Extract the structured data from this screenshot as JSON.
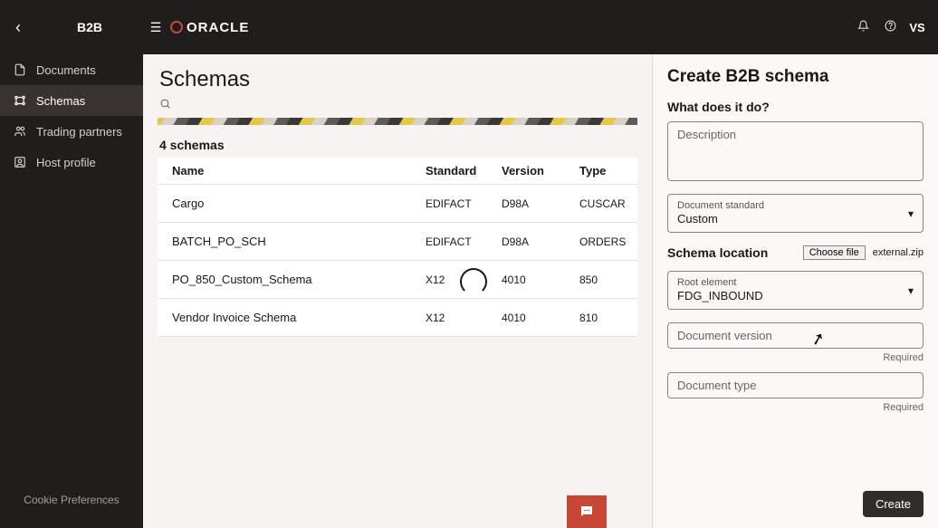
{
  "topbar": {
    "app_title": "B2B",
    "logo_text": "ORACLE",
    "user_initials": "VS"
  },
  "sidebar": {
    "items": [
      {
        "label": "Documents"
      },
      {
        "label": "Schemas"
      },
      {
        "label": "Trading partners"
      },
      {
        "label": "Host profile"
      }
    ],
    "cookie_label": "Cookie Preferences"
  },
  "main": {
    "page_title": "Schemas",
    "count_text": "4 schemas",
    "columns": {
      "name": "Name",
      "standard": "Standard",
      "version": "Version",
      "type": "Type"
    },
    "rows": [
      {
        "name": "Cargo",
        "standard": "EDIFACT",
        "version": "D98A",
        "type": "CUSCAR"
      },
      {
        "name": "BATCH_PO_SCH",
        "standard": "EDIFACT",
        "version": "D98A",
        "type": "ORDERS"
      },
      {
        "name": "PO_850_Custom_Schema",
        "standard": "X12",
        "version": "4010",
        "type": "850"
      },
      {
        "name": "Vendor Invoice Schema",
        "standard": "X12",
        "version": "4010",
        "type": "810"
      }
    ]
  },
  "panel": {
    "title": "Create B2B schema",
    "what_label": "What does it do?",
    "description_placeholder": "Description",
    "doc_standard_label": "Document standard",
    "doc_standard_value": "Custom",
    "schema_location_label": "Schema location",
    "choose_file_label": "Choose file",
    "file_name": "external.zip",
    "root_element_label": "Root element",
    "root_element_value": "FDG_INBOUND",
    "doc_version_label": "Document version",
    "doc_type_label": "Document type",
    "required_text": "Required",
    "create_button": "Create"
  }
}
